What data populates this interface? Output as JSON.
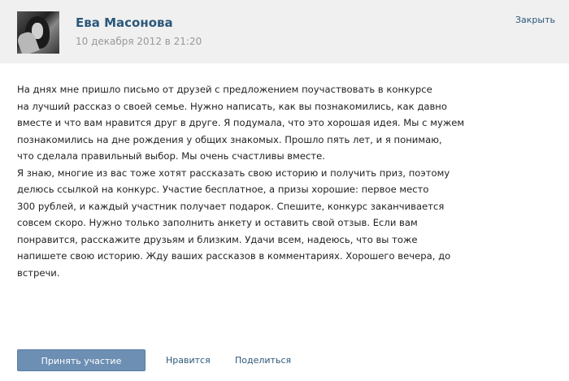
{
  "header": {
    "author_name": "Ева Масонова",
    "date": "10 декабря 2012 в 21:20",
    "close_label": "Закрыть"
  },
  "post": {
    "lines": [
      "На днях мне пришло письмо от друзей с предложением поучаствовать в конкурсе",
      "на лучший рассказ о своей семье. Нужно написать, как вы познакомились, как давно",
      "вместе и что вам нравится друг в друге. Я подумала, что это хорошая идея. Мы с мужем",
      "познакомились на дне рождения у общих знакомых. Прошло пять лет, и я понимаю,",
      "что сделала правильный выбор. Мы очень счастливы вместе.",
      "Я знаю, многие из вас тоже хотят рассказать свою историю и получить приз, поэтому",
      "делюсь ссылкой на конкурс. Участие бесплатное, а призы хорошие: первое место",
      "300 рублей, и каждый участник получает подарок. Спешите, конкурс заканчивается",
      "совсем скоро. Нужно только заполнить анкету и оставить свой отзыв. Если вам",
      "понравится, расскажите друзьям и близким. Удачи всем, надеюсь, что вы тоже",
      "напишете свою историю. Жду ваших рассказов в комментариях. Хорошего вечера, до",
      "встречи."
    ]
  },
  "actions": {
    "primary_label": "Принять участие",
    "link_one_label": "Нравится",
    "link_two_label": "Поделиться"
  }
}
